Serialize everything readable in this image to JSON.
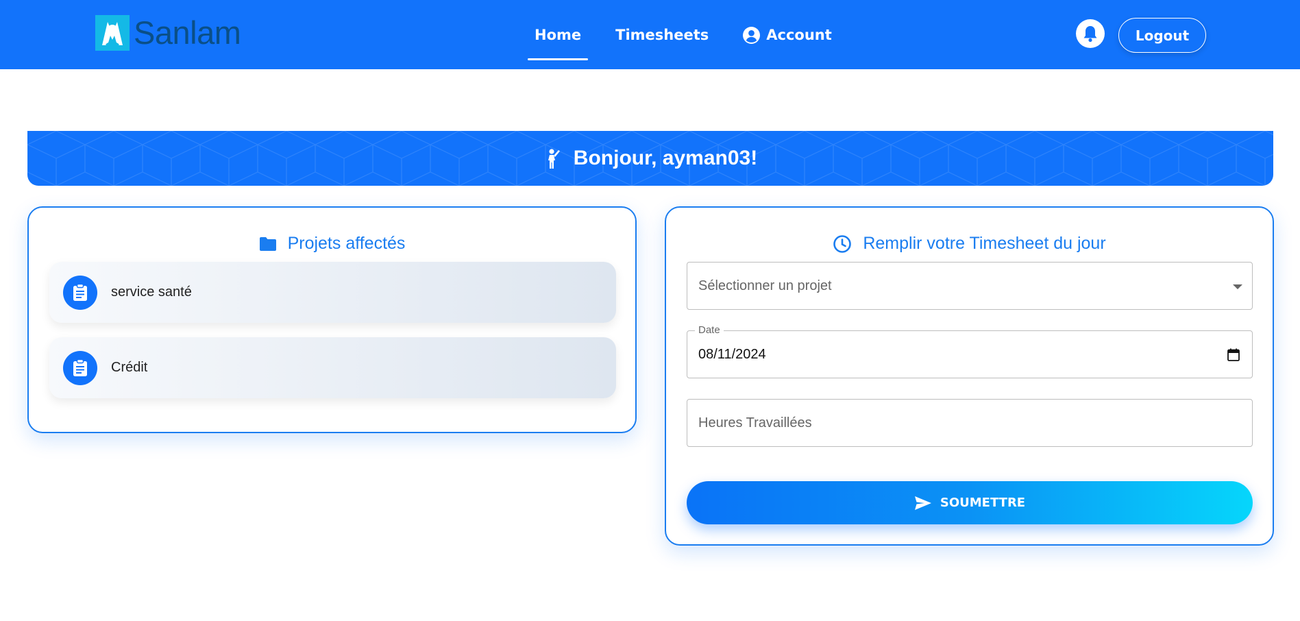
{
  "brand": {
    "name": "Sanlam",
    "icon": "sanlam-logo-icon"
  },
  "nav": {
    "home_label": "Home",
    "timesheets_label": "Timesheets",
    "account_label": "Account",
    "account_icon": "user-circle-icon"
  },
  "header_actions": {
    "bell_icon": "bell-icon",
    "logout_label": "Logout"
  },
  "banner": {
    "icon": "person-waving-icon",
    "greeting": "Bonjour, ayman03!"
  },
  "projects_card": {
    "icon": "folder-icon",
    "title": "Projets affectés",
    "items": [
      {
        "icon": "clipboard-icon",
        "label": "service santé"
      },
      {
        "icon": "clipboard-icon",
        "label": "Crédit"
      }
    ]
  },
  "timesheet_card": {
    "icon": "clock-icon",
    "title": "Remplir votre Timesheet du jour",
    "project_select": {
      "placeholder": "Sélectionner un projet",
      "value": ""
    },
    "date_field": {
      "label": "Date",
      "value": "08/11/2024",
      "icon": "calendar-icon"
    },
    "hours_field": {
      "placeholder": "Heures Travaillées",
      "value": ""
    },
    "submit": {
      "label": "SOUMETTRE",
      "icon": "send-icon"
    }
  },
  "colors": {
    "primary": "#1273fb",
    "accent_cyan": "#06d6fb",
    "logo_bg": "#14b9e6",
    "logo_text": "#0a4f87",
    "card_border": "#1a7df0"
  }
}
